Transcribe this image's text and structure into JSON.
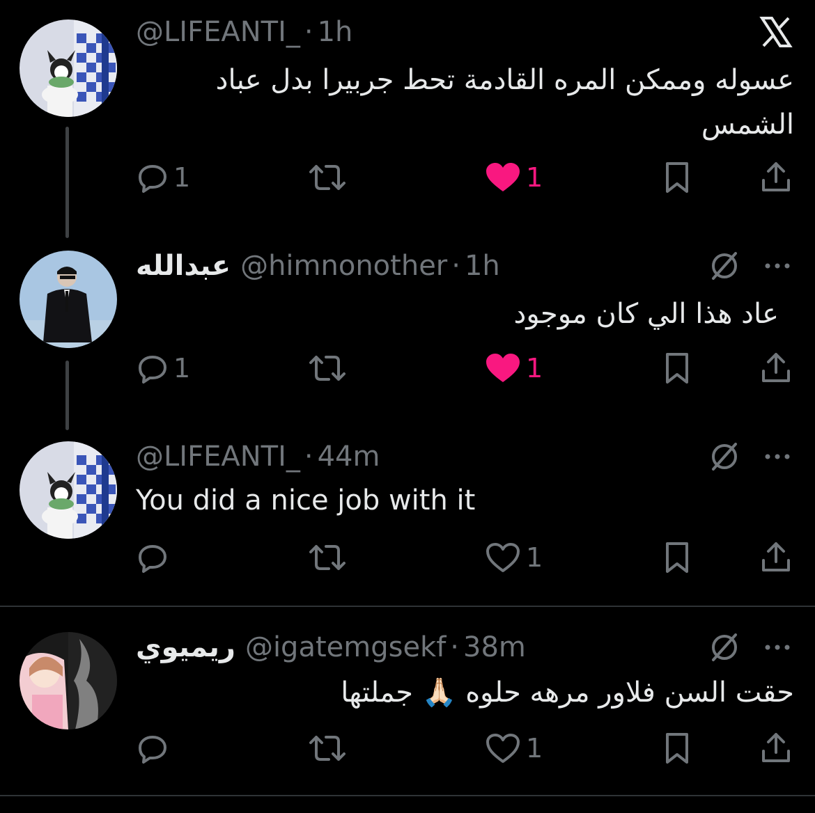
{
  "colors": {
    "background": "#000000",
    "text": "#e7e9ea",
    "muted": "#71767b",
    "like": "#f91880",
    "divider": "#2f3336"
  },
  "tweets": [
    {
      "display_name": "",
      "handle": "@LIFEANTI_",
      "time": "1h",
      "text_lines": [
        "عسوله وممكن المره القادمة تحط جربيرا بدل عباد",
        "الشمس"
      ],
      "reply_count": "1",
      "like_count": "1",
      "liked": true,
      "top_icon": "x-close-icon"
    },
    {
      "display_name": "عبدالله",
      "handle": "@himnonother",
      "time": "1h",
      "text_lines": [
        "عاد هذا الي كان موجود"
      ],
      "reply_count": "1",
      "like_count": "1",
      "liked": true,
      "top_icon": "grok-icon"
    },
    {
      "display_name": "",
      "handle": "@LIFEANTI_",
      "time": "44m",
      "text_lines": [
        "You did a nice job with it"
      ],
      "reply_count": "",
      "like_count": "1",
      "liked": false,
      "top_icon": "grok-icon"
    },
    {
      "display_name": "ريميوي",
      "handle": "@igatemgsekf",
      "time": "38m",
      "text_lines": [
        "حقت السن فلاور مرهه حلوه 🙏🏻 جملتها"
      ],
      "reply_count": "",
      "like_count": "1",
      "liked": false,
      "top_icon": "grok-icon"
    }
  ],
  "separator": "·"
}
